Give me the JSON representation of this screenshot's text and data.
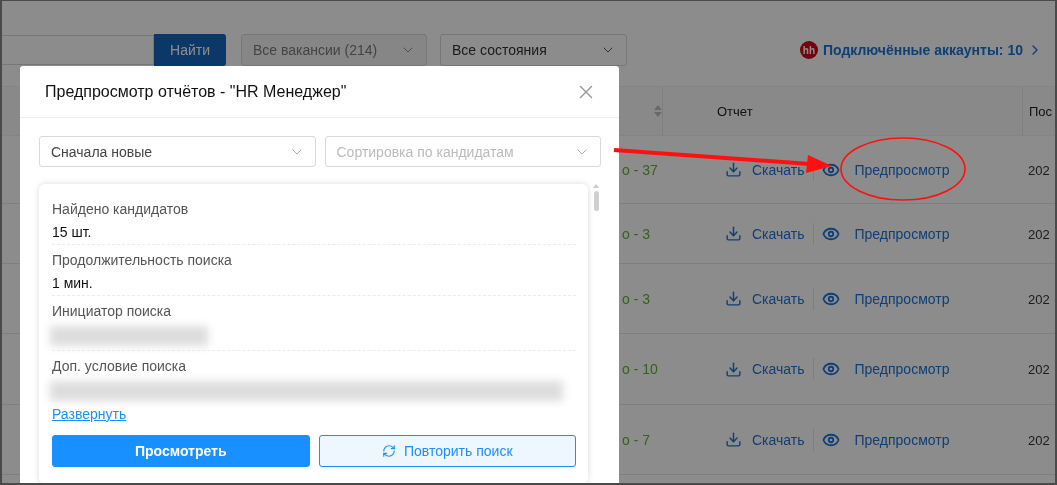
{
  "toolbar": {
    "search_button": "Найти",
    "vacancy_filter": {
      "value": "Все вакансии (214)",
      "disabled": true
    },
    "state_filter": {
      "value": "Все состояния",
      "disabled": false
    },
    "accounts_link": {
      "logo": "hh",
      "label": "Подключённые аккаунты: 10"
    }
  },
  "table": {
    "columns": [
      {
        "label": "Отчет"
      },
      {
        "label": "Пос"
      }
    ],
    "rows": [
      {
        "status": "о - 37",
        "download_link": "Скачать",
        "preview_link": "Предпросмотр",
        "last_column": "202"
      },
      {
        "status": "о - 3",
        "download_link": "Скачать",
        "preview_link": "Предпросмотр",
        "last_column": "202"
      },
      {
        "status": "о - 3",
        "download_link": "Скачать",
        "preview_link": "Предпросмотр",
        "last_column": "202"
      },
      {
        "status": "о - 10",
        "download_link": "Скачать",
        "preview_link": "Предпросмотр",
        "last_column": "202"
      },
      {
        "status": "о - 7",
        "download_link": "Скачать",
        "preview_link": "Предпросмотр",
        "last_column": "202"
      }
    ]
  },
  "modal": {
    "title": "Предпросмотр отчётов - \"HR Менеджер\"",
    "sort_select": {
      "value": "Сначала новые"
    },
    "candidate_sort_select": {
      "placeholder": "Сортировка по кандидатам"
    },
    "details": [
      {
        "label": "Найдено кандидатов",
        "kind": "text",
        "value": "15 шт."
      },
      {
        "label": "Продолжительность поиска",
        "kind": "text",
        "value": "1 мин."
      },
      {
        "label": "Инициатор поиска",
        "kind": "redacted"
      },
      {
        "label": "Доп. условие поиска",
        "kind": "redactedwide"
      }
    ],
    "expand_link": "Развернуть",
    "buttons": [
      {
        "label": "Просмотреть",
        "kind": "primary"
      },
      {
        "label": "Повторить поиск",
        "kind": "secondary"
      }
    ]
  }
}
